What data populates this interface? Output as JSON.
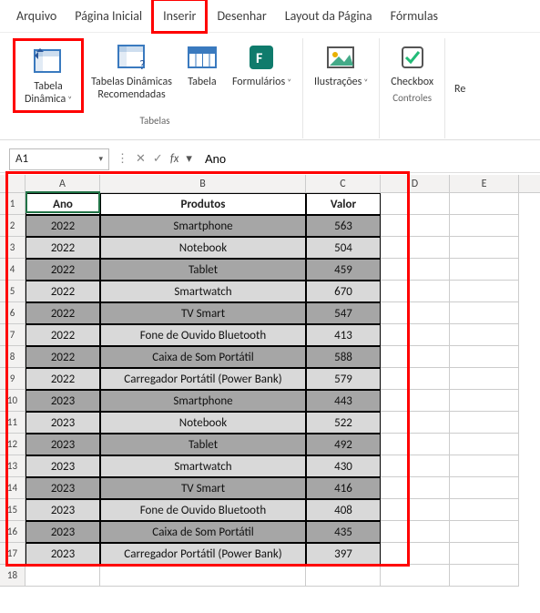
{
  "menubar": {
    "items": [
      "Arquivo",
      "Página Inicial",
      "Inserir",
      "Desenhar",
      "Layout da Página",
      "Fórmulas"
    ],
    "highlighted_index": 2
  },
  "ribbon": {
    "groups": [
      {
        "label": "Tabelas",
        "buttons": [
          {
            "name": "pivot-table-button",
            "label": "Tabela\nDinâmica",
            "icon": "pivot",
            "dropdown": true,
            "highlighted": true
          },
          {
            "name": "recommended-pivot-button",
            "label": "Tabelas Dinâmicas\nRecomendadas",
            "icon": "pivot-rec"
          },
          {
            "name": "table-button",
            "label": "Tabela",
            "icon": "table"
          },
          {
            "name": "forms-button",
            "label": "Formulários",
            "icon": "forms",
            "dropdown": true
          }
        ]
      },
      {
        "label": "",
        "buttons": [
          {
            "name": "illustrations-button",
            "label": "Ilustrações",
            "icon": "illustrations",
            "dropdown": true
          }
        ]
      },
      {
        "label": "Controles",
        "buttons": [
          {
            "name": "checkbox-button",
            "label": "Checkbox",
            "icon": "checkbox"
          }
        ]
      }
    ],
    "overflow_label": "Re"
  },
  "namebox": {
    "value": "A1"
  },
  "formula": {
    "value": "Ano"
  },
  "columns_extra": [
    "D",
    "E"
  ],
  "chart_data": {
    "type": "table",
    "headers": [
      "Ano",
      "Produtos",
      "Valor"
    ],
    "rows": [
      [
        "2022",
        "Smartphone",
        563
      ],
      [
        "2022",
        "Notebook",
        504
      ],
      [
        "2022",
        "Tablet",
        459
      ],
      [
        "2022",
        "Smartwatch",
        670
      ],
      [
        "2022",
        "TV Smart",
        547
      ],
      [
        "2022",
        "Fone de Ouvido Bluetooth",
        413
      ],
      [
        "2022",
        "Caixa de Som Portátil",
        588
      ],
      [
        "2022",
        "Carregador Portátil (Power Bank)",
        579
      ],
      [
        "2023",
        "Smartphone",
        443
      ],
      [
        "2023",
        "Notebook",
        522
      ],
      [
        "2023",
        "Tablet",
        492
      ],
      [
        "2023",
        "Smartwatch",
        430
      ],
      [
        "2023",
        "TV Smart",
        416
      ],
      [
        "2023",
        "Fone de Ouvido Bluetooth",
        408
      ],
      [
        "2023",
        "Caixa de Som Portátil",
        435
      ],
      [
        "2023",
        "Carregador Portátil (Power Bank)",
        397
      ]
    ]
  }
}
